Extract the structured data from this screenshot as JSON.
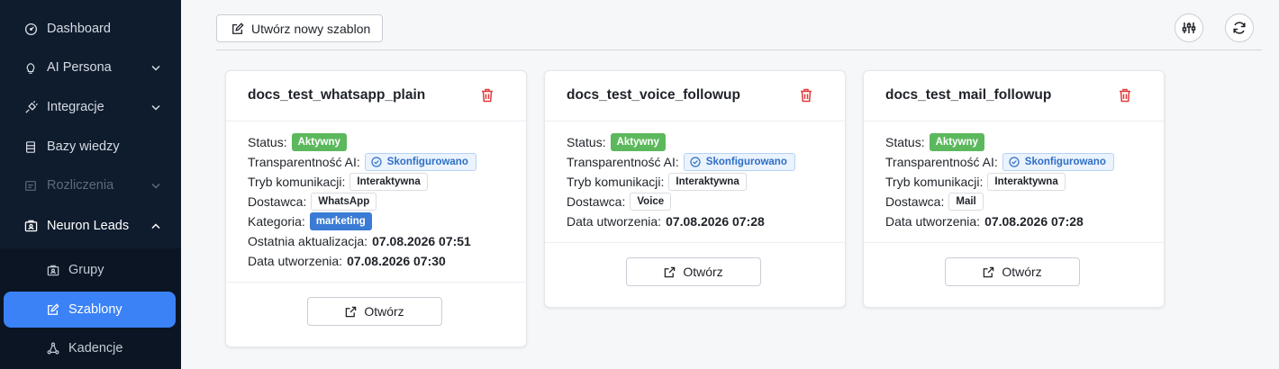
{
  "sidebar": {
    "items": [
      {
        "label": "Dashboard",
        "icon": "gauge-icon"
      },
      {
        "label": "AI Persona",
        "icon": "lightbulb-icon"
      },
      {
        "label": "Integracje",
        "icon": "plug-icon"
      },
      {
        "label": "Bazy wiedzy",
        "icon": "database-icon"
      },
      {
        "label": "Rozliczenia",
        "icon": "billing-icon"
      },
      {
        "label": "Neuron Leads",
        "icon": "leads-icon"
      }
    ],
    "sub_items": [
      {
        "label": "Grupy",
        "icon": "group-icon"
      },
      {
        "label": "Szablony",
        "icon": "template-icon"
      },
      {
        "label": "Kadencje",
        "icon": "cadence-icon"
      }
    ]
  },
  "toolbar": {
    "new_template_label": "Utwórz nowy szablon"
  },
  "labels": {
    "status": "Status:",
    "transparency": "Transparentność AI:",
    "mode": "Tryb komunikacji:",
    "provider": "Dostawca:",
    "category": "Kategoria:",
    "last_update": "Ostatnia aktualizacja:",
    "created": "Data utworzenia:",
    "open": "Otwórz"
  },
  "cards": [
    {
      "title": "docs_test_whatsapp_plain",
      "status": "Aktywny",
      "transparency": "Skonfigurowano",
      "mode": "Interaktywna",
      "provider": "WhatsApp",
      "category": "marketing",
      "last_update": "07.08.2026 07:51",
      "created": "07.08.2026 07:30"
    },
    {
      "title": "docs_test_voice_followup",
      "status": "Aktywny",
      "transparency": "Skonfigurowano",
      "mode": "Interaktywna",
      "provider": "Voice",
      "created": "07.08.2026 07:28"
    },
    {
      "title": "docs_test_mail_followup",
      "status": "Aktywny",
      "transparency": "Skonfigurowano",
      "mode": "Interaktywna",
      "provider": "Mail",
      "created": "07.08.2026 07:28"
    }
  ],
  "colors": {
    "sidebar_bg": "#0f1c2e",
    "active_item": "#3b82f6",
    "status_green": "#5cb85c",
    "category_blue": "#3a7bd5",
    "trash_red": "#e03b3b"
  }
}
